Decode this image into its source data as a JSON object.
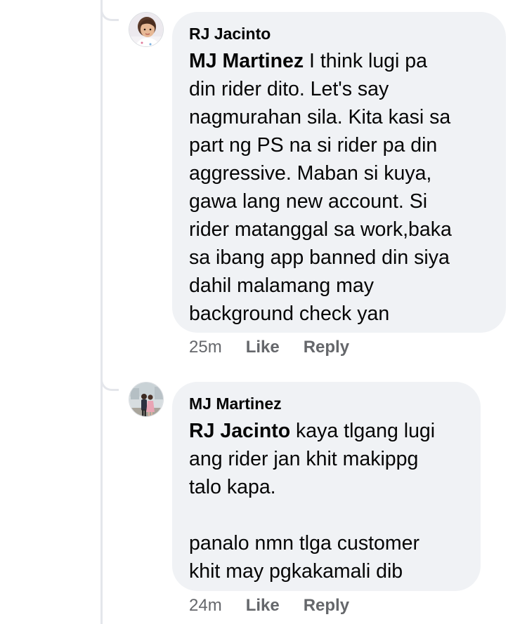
{
  "comments": [
    {
      "author": "RJ Jacinto",
      "mention": "MJ Martinez",
      "text": " I think lugi pa\ndin rider dito. Let's say\nnagmurahan sila. Kita kasi sa\npart ng PS na si rider pa din\naggressive. Maban si kuya,\ngawa lang new account. Si\nrider matanggal sa work,baka\nsa ibang app banned din siya\ndahil malamang may\nbackground check yan",
      "time": "25m",
      "like_label": "Like",
      "reply_label": "Reply",
      "avatar_icon": "profile-photo-child"
    },
    {
      "author": "MJ Martinez",
      "mention": "RJ Jacinto",
      "text": " kaya tlgang lugi\nang rider jan khit makippg\ntalo kapa.\n\npanalo nmn tlga customer\nkhit may pgkakamali dib",
      "time": "24m",
      "like_label": "Like",
      "reply_label": "Reply",
      "avatar_icon": "profile-photo-couple"
    }
  ],
  "colors": {
    "bubble": "#f0f2f5",
    "text": "#050505",
    "meta": "#65676b",
    "thread_line": "#e4e6eb"
  }
}
